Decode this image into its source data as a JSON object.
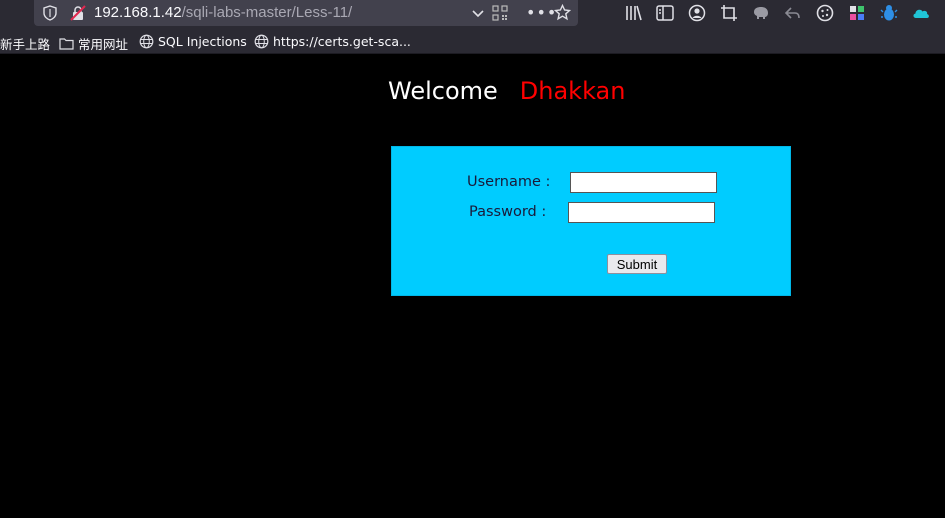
{
  "browser": {
    "url_host": "192.168.1.42",
    "url_path": "/sqli-labs-master/Less-11/",
    "more_label": "•••"
  },
  "bookmarks": [
    {
      "label": "新手上路",
      "icon": "none"
    },
    {
      "label": "常用网址",
      "icon": "folder-icon"
    },
    {
      "label": "SQL Injections",
      "icon": "globe-icon"
    },
    {
      "label": "https://certs.get-sca...",
      "icon": "globe-icon"
    }
  ],
  "page": {
    "welcome": "Welcome",
    "name": "Dhakkan",
    "form": {
      "username_label": "Username :",
      "password_label": "Password :",
      "username_value": "",
      "password_value": "",
      "submit_label": "Submit"
    }
  },
  "colors": {
    "background": "#000000",
    "welcome": "#ffffff",
    "name": "#ff0000",
    "login_box": "#00ccff"
  }
}
